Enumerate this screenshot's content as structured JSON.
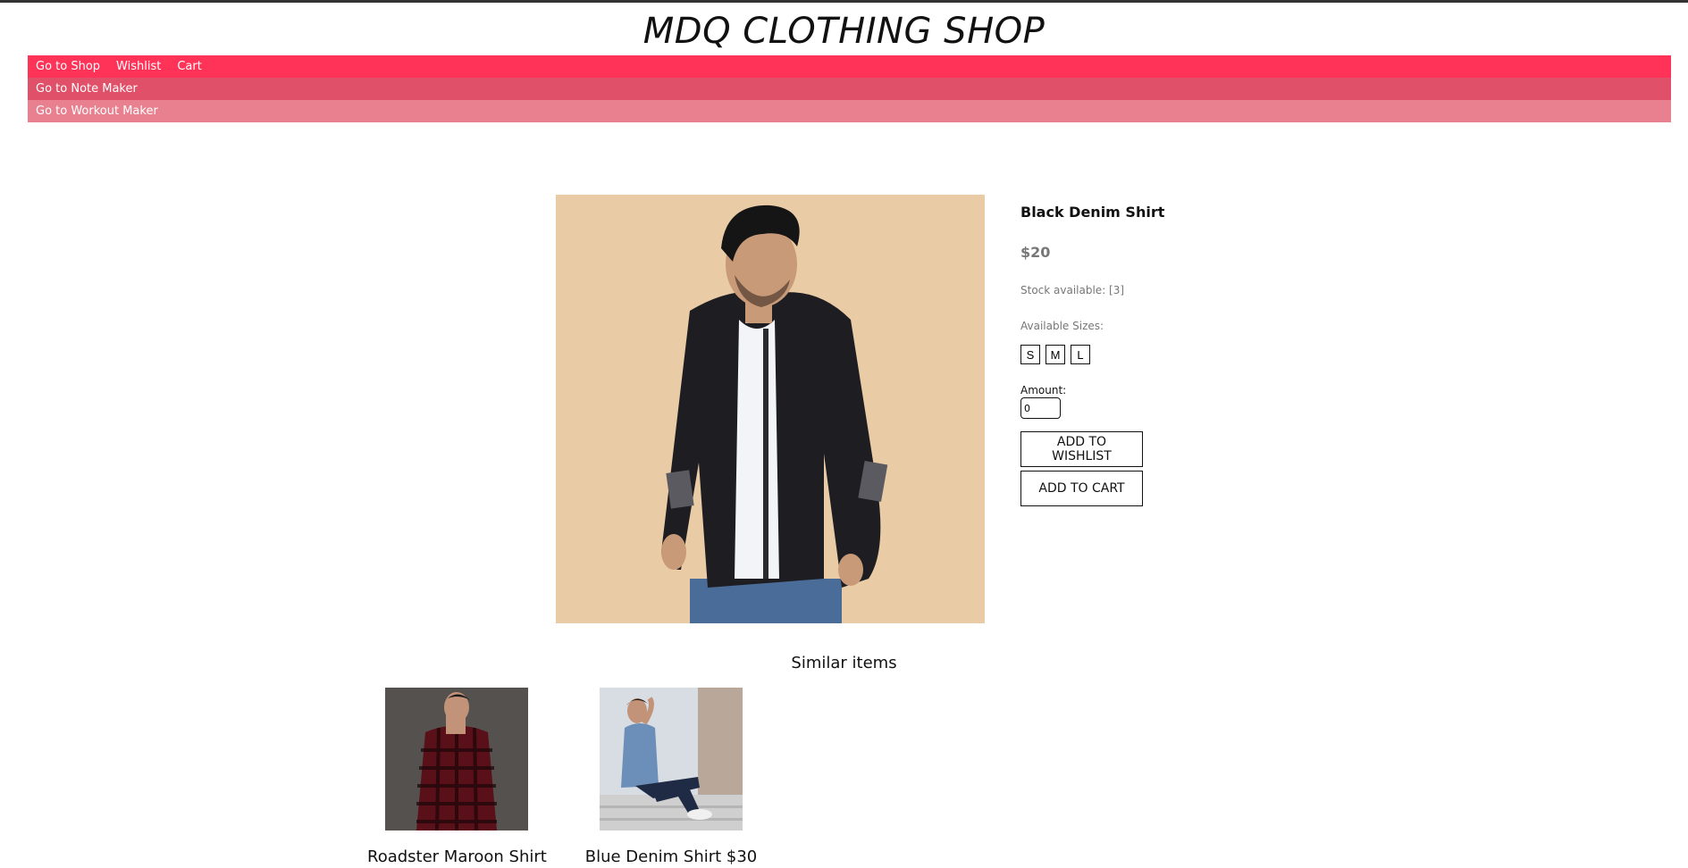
{
  "site": {
    "title": "MDQ CLOTHING SHOP"
  },
  "nav": {
    "row1": [
      "Go to Shop",
      "Wishlist",
      "Cart"
    ],
    "row2": "Go to Note Maker",
    "row3": "Go to Workout Maker"
  },
  "product": {
    "name": "Black Denim Shirt",
    "price": "$20",
    "stock": "Stock available: [3]",
    "sizes_label": "Available Sizes:",
    "sizes": [
      "S",
      "M",
      "L"
    ],
    "amount_label": "Amount:",
    "amount_value": "0",
    "wishlist_button": "ADD TO WISHLIST",
    "cart_button": "ADD TO CART"
  },
  "similar": {
    "title": "Similar items",
    "items": [
      {
        "label": "Roadster Maroon Shirt"
      },
      {
        "label": "Blue Denim Shirt $30"
      }
    ]
  },
  "colors": {
    "nav_row1": "#ff3358",
    "nav_row2": "#e05068",
    "nav_row3": "#e88090"
  }
}
